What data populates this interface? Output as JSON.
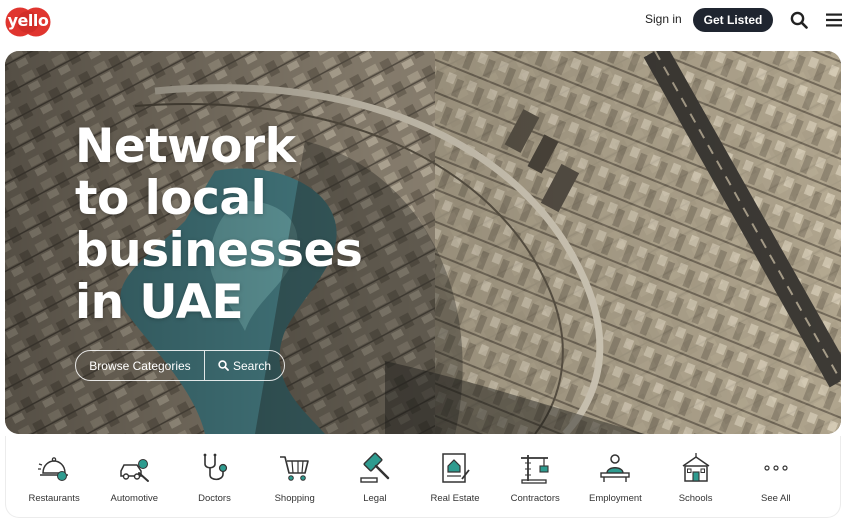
{
  "header": {
    "logo_text": "yello",
    "signin_label": "Sign in",
    "get_listed_label": "Get Listed",
    "search_icon": "search-icon",
    "menu_icon": "hamburger-menu-icon"
  },
  "hero": {
    "title_lines": [
      "Network",
      "to local",
      "businesses",
      "in UAE"
    ],
    "browse_label": "Browse Categories",
    "search_label": "Search"
  },
  "categories": [
    {
      "label": "Restaurants",
      "icon": "restaurant-cloche-icon"
    },
    {
      "label": "Automotive",
      "icon": "car-repair-icon"
    },
    {
      "label": "Doctors",
      "icon": "stethoscope-icon"
    },
    {
      "label": "Shopping",
      "icon": "shopping-cart-icon"
    },
    {
      "label": "Legal",
      "icon": "gavel-icon"
    },
    {
      "label": "Real Estate",
      "icon": "property-document-icon"
    },
    {
      "label": "Contractors",
      "icon": "crane-icon"
    },
    {
      "label": "Employment",
      "icon": "person-at-desk-icon"
    },
    {
      "label": "Schools",
      "icon": "school-building-icon"
    },
    {
      "label": "See All",
      "icon": "more-dots-icon"
    }
  ],
  "colors": {
    "brand_red": "#e0352f",
    "dark_button": "#1f2530",
    "icon_accent": "#2e9b8f",
    "icon_stroke": "#333333"
  }
}
